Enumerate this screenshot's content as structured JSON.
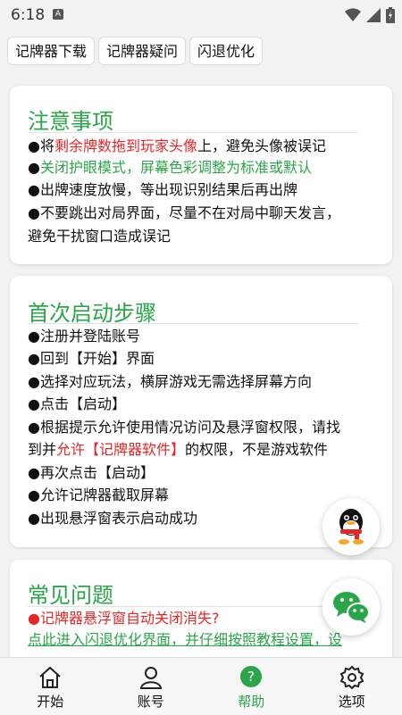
{
  "status_bar": {
    "time": "6:18",
    "notif_letter": "A"
  },
  "tabs": [
    "记牌器下载",
    "记牌器疑问",
    "闪退优化"
  ],
  "notice": {
    "title": "注意事项",
    "line1_prefix": "●将",
    "line1_red": "剩余牌数拖到玩家头像",
    "line1_suffix": "上，避免头像被误记",
    "line2_dot": "●",
    "line2_green": "关闭护眼模式，屏幕色彩调整为标准或默认",
    "line3": "●出牌速度放慢，等出现识别结果后再出牌",
    "line4a": "●不要跳出对局界面，尽量不在对局中聊天发言，",
    "line4b": "避免干扰窗口造成误记"
  },
  "steps": {
    "title": "首次启动步骤",
    "s1": "●注册并登陆账号",
    "s2": "●回到【开始】界面",
    "s3": "●选择对应玩法，横屏游戏无需选择屏幕方向",
    "s4": "●点击【启动】",
    "s5a": "●根据提示允许使用情况访问及悬浮窗权限，请找",
    "s5b_prefix": "到并",
    "s5b_red": "允许【记牌器软件】",
    "s5b_suffix": "的权限，不是游戏软件",
    "s6": "●再次点击【启动】",
    "s7": "●允许记牌器截取屏幕",
    "s8": "●出现悬浮窗表示启动成功"
  },
  "faq": {
    "title": "常见问题",
    "q1_dot": "●",
    "q1": "记牌器悬浮窗自动关闭消失?",
    "a1": "点此进入闪退优化界面，并仔细按照教程设置，设"
  },
  "bottom_nav": [
    {
      "label": "开始",
      "icon": "home-icon"
    },
    {
      "label": "账号",
      "icon": "user-icon"
    },
    {
      "label": "帮助",
      "icon": "help-icon"
    },
    {
      "label": "选项",
      "icon": "settings-icon"
    }
  ],
  "colors": {
    "accent": "#2aa64a",
    "warning": "#e62626"
  }
}
